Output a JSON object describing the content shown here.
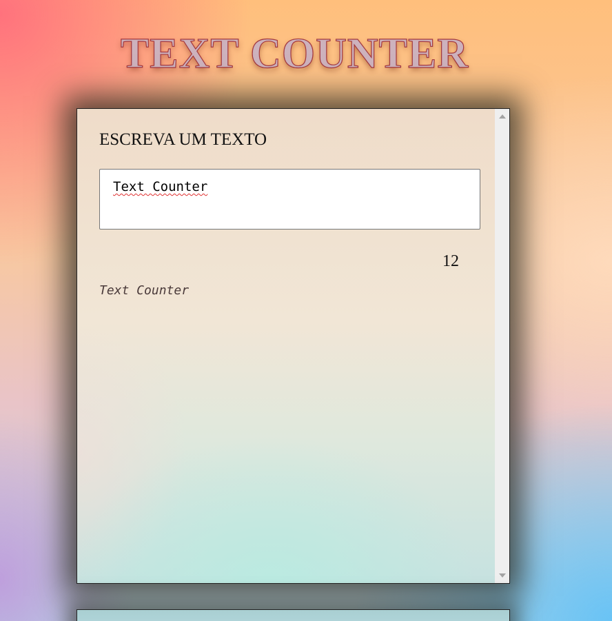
{
  "header": {
    "title": "TEXT COUNTER"
  },
  "counter_card": {
    "label": "ESCREVA UM TEXTO",
    "input_value": "Text Counter",
    "character_count": "12",
    "preview_text": "Text Counter"
  },
  "colors": {
    "title_fill": "#cdb2bd",
    "title_stroke": "#a3383f",
    "card_border": "#222222",
    "scrollbar_track": "#efefef"
  }
}
